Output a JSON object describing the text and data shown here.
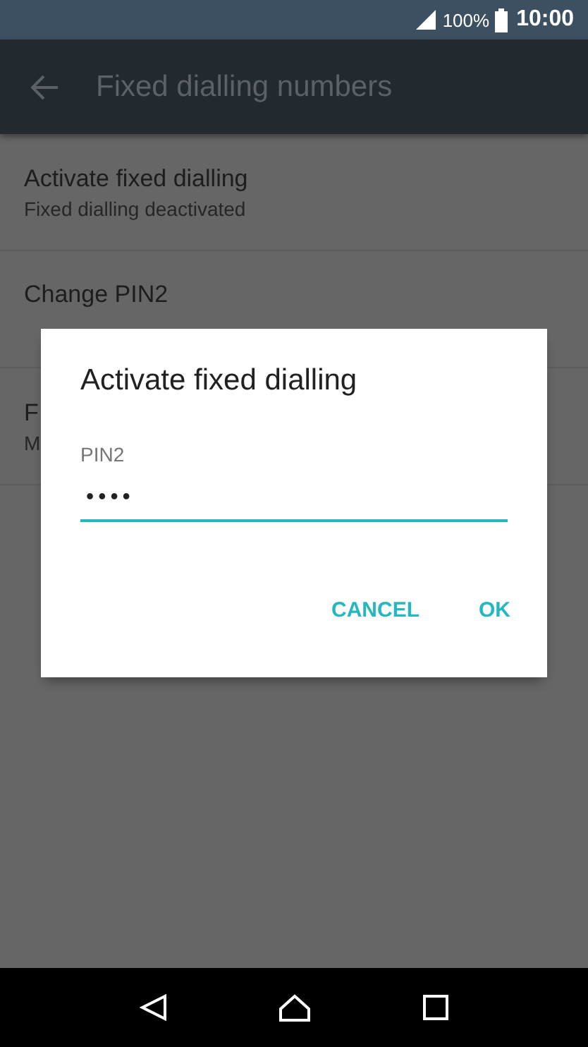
{
  "status_bar": {
    "battery": "100%",
    "time": "10:00"
  },
  "app_bar": {
    "title": "Fixed dialling numbers"
  },
  "items": [
    {
      "title": "Activate fixed dialling",
      "subtitle": "Fixed dialling deactivated"
    },
    {
      "title": "Change PIN2"
    },
    {
      "title": "F",
      "subtitle": "M"
    }
  ],
  "dialog": {
    "title": "Activate fixed dialling",
    "field_label": "PIN2",
    "value": "••••",
    "buttons": [
      "CANCEL",
      "OK"
    ]
  }
}
